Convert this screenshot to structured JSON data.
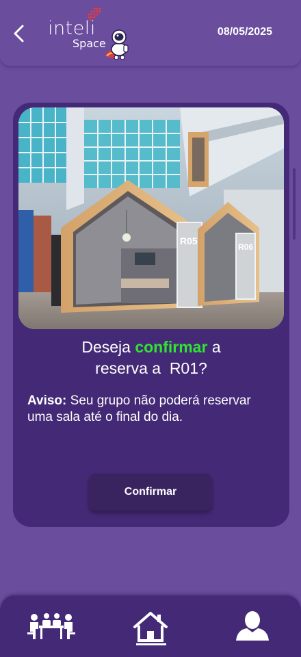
{
  "header": {
    "back_icon": "chevron-left-icon",
    "logo_word": "inteli",
    "logo_sub": "Space",
    "date": "08/05/2025"
  },
  "card": {
    "image_icon": "meeting-room-photo",
    "question": {
      "prefix": "Deseja ",
      "highlight": "confirmar",
      "suffix": " a",
      "line2": "reserva a  R01?"
    },
    "notice": {
      "label": "Aviso:",
      "text": " Seu grupo não poderá reservar uma sala até o final do dia."
    },
    "confirm_label": "Confirmar"
  },
  "nav": {
    "items": [
      {
        "icon": "meeting-icon"
      },
      {
        "icon": "home-icon",
        "active": true
      },
      {
        "icon": "user-icon"
      }
    ]
  },
  "colors": {
    "background": "#6b4d9e",
    "card": "#442a76",
    "button": "#3a2460",
    "highlight": "#2ee62e"
  }
}
